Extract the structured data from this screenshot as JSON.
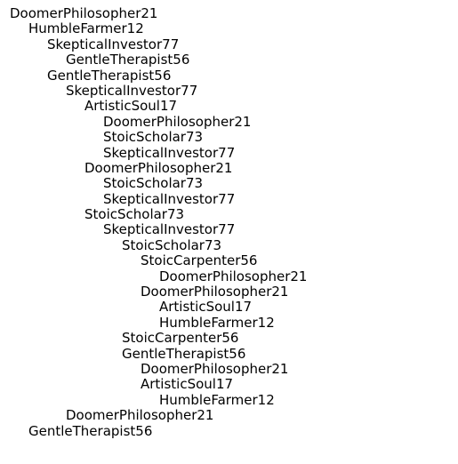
{
  "tree": {
    "nodes": [
      {
        "label": "DoomerPhilosopher21",
        "depth": 0
      },
      {
        "label": "HumbleFarmer12",
        "depth": 1
      },
      {
        "label": "SkepticalInvestor77",
        "depth": 2
      },
      {
        "label": "GentleTherapist56",
        "depth": 3
      },
      {
        "label": "GentleTherapist56",
        "depth": 2
      },
      {
        "label": "SkepticalInvestor77",
        "depth": 3
      },
      {
        "label": "ArtisticSoul17",
        "depth": 4
      },
      {
        "label": "DoomerPhilosopher21",
        "depth": 5
      },
      {
        "label": "StoicScholar73",
        "depth": 5
      },
      {
        "label": "SkepticalInvestor77",
        "depth": 5
      },
      {
        "label": "DoomerPhilosopher21",
        "depth": 4
      },
      {
        "label": "StoicScholar73",
        "depth": 5
      },
      {
        "label": "SkepticalInvestor77",
        "depth": 5
      },
      {
        "label": "StoicScholar73",
        "depth": 4
      },
      {
        "label": "SkepticalInvestor77",
        "depth": 5
      },
      {
        "label": "StoicScholar73",
        "depth": 6
      },
      {
        "label": "StoicCarpenter56",
        "depth": 7
      },
      {
        "label": "DoomerPhilosopher21",
        "depth": 8
      },
      {
        "label": "DoomerPhilosopher21",
        "depth": 7
      },
      {
        "label": "ArtisticSoul17",
        "depth": 8
      },
      {
        "label": "HumbleFarmer12",
        "depth": 8
      },
      {
        "label": "StoicCarpenter56",
        "depth": 6
      },
      {
        "label": "GentleTherapist56",
        "depth": 6
      },
      {
        "label": "DoomerPhilosopher21",
        "depth": 7
      },
      {
        "label": "ArtisticSoul17",
        "depth": 7
      },
      {
        "label": "HumbleFarmer12",
        "depth": 8
      },
      {
        "label": "DoomerPhilosopher21",
        "depth": 3
      },
      {
        "label": "GentleTherapist56",
        "depth": 1
      }
    ]
  }
}
